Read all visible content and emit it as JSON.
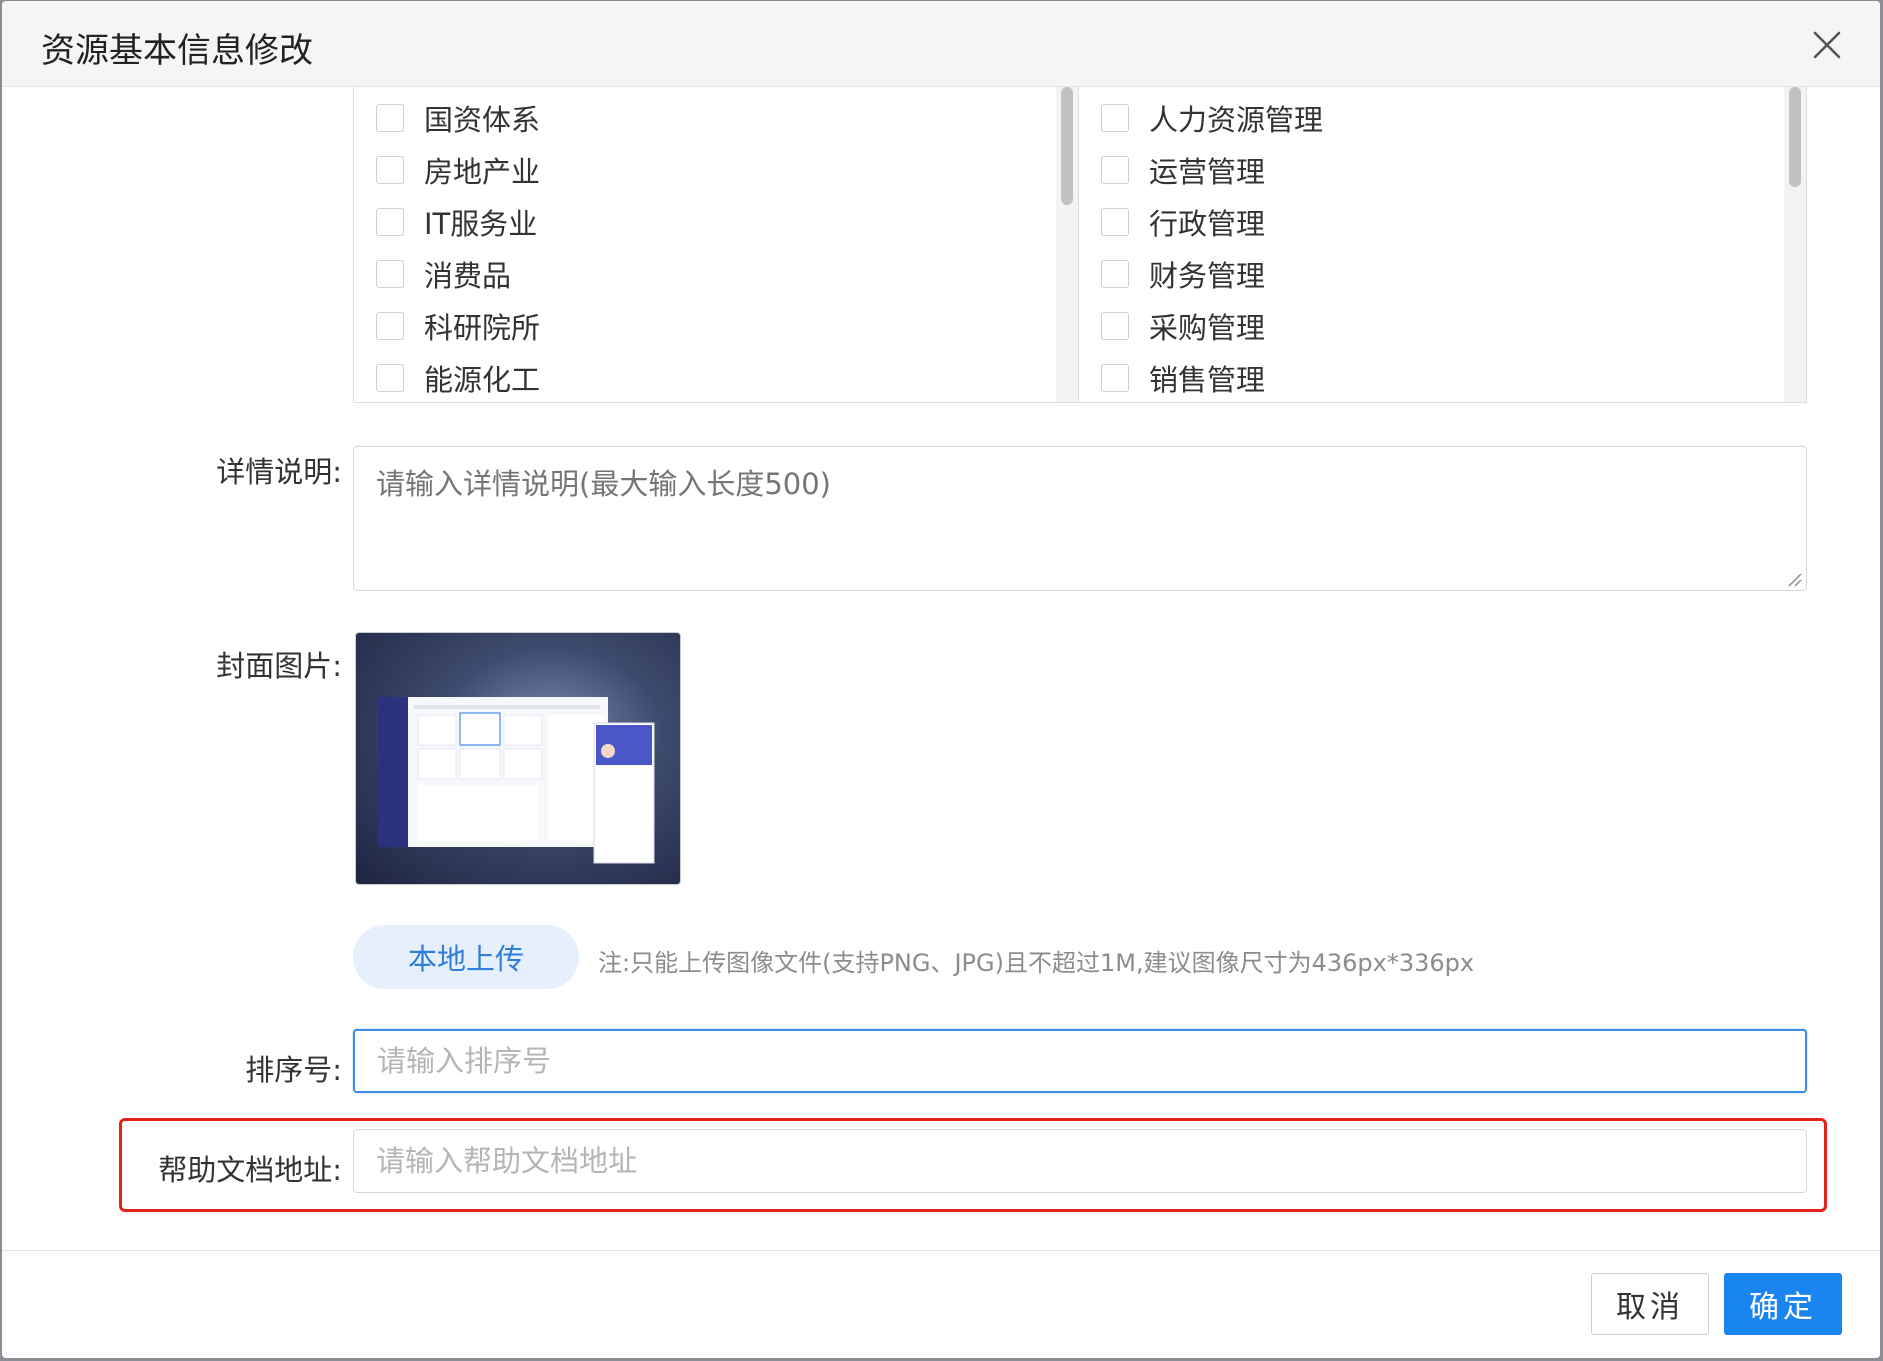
{
  "dialog": {
    "title": "资源基本信息修改",
    "close_icon": "close-icon"
  },
  "industries": [
    "国资体系",
    "房地产业",
    "IT服务业",
    "消费品",
    "科研院所",
    "能源化工"
  ],
  "functions": [
    "人力资源管理",
    "运营管理",
    "行政管理",
    "财务管理",
    "采购管理",
    "销售管理"
  ],
  "detail": {
    "label": "详情说明:",
    "placeholder": "请输入详情说明(最大输入长度500)"
  },
  "cover": {
    "label": "封面图片:",
    "upload_label": "本地上传",
    "note": "注:只能上传图像文件(支持PNG、JPG)且不超过1M,建议图像尺寸为436px*336px"
  },
  "sort": {
    "label": "排序号:",
    "placeholder": "请输入排序号"
  },
  "help_doc": {
    "label": "帮助文档地址:",
    "placeholder": "请输入帮助文档地址"
  },
  "footer": {
    "cancel_label": "取消",
    "ok_label": "确定"
  },
  "colors": {
    "primary": "#1a85f0",
    "highlight": "#e2231a",
    "focus_border": "#3c8ee6"
  }
}
